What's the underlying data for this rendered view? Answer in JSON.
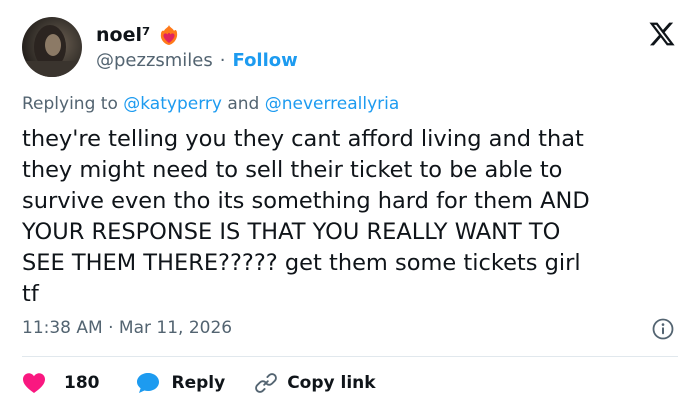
{
  "author": {
    "display_name": "noel⁷",
    "handle": "@pezzsmiles",
    "separator": "·",
    "follow_label": "Follow"
  },
  "reply_context": {
    "prefix": "Replying to",
    "mention_1": "@katyperry",
    "conjunction": "and",
    "mention_2": "@neverreallyria"
  },
  "tweet": {
    "text": "they're telling you they cant afford living and that\nthey might need to sell their ticket to be able to\nsurvive even tho its something hard for them AND\nYOUR RESPONSE IS THAT YOU REALLY WANT TO\nSEE THEM THERE????? get them some tickets girl\ntf",
    "timestamp": "11:38 AM · Mar 11, 2026"
  },
  "actions": {
    "like_count": "180",
    "reply_label": "Reply",
    "copy_label": "Copy link"
  },
  "colors": {
    "accent": "#1d9bf0",
    "like": "#f91880",
    "secondary_text": "#536471"
  },
  "icons": {
    "badge": "heart-on-fire-icon",
    "logo": "x-logo-icon",
    "info": "info-icon",
    "like": "heart-icon",
    "reply": "speech-bubble-icon",
    "copy": "link-icon"
  }
}
